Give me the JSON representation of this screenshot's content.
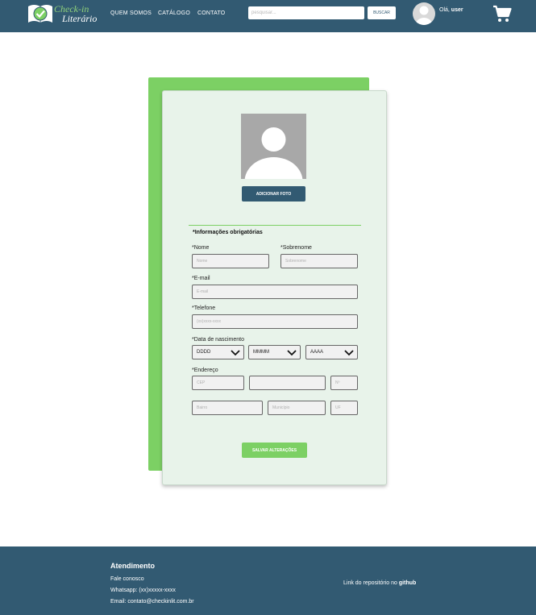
{
  "header": {
    "logo_line1": "Check-in",
    "logo_line2": "Literário",
    "nav": [
      "QUEM SOMOS",
      "CATÁLOGO",
      "CONTATO"
    ],
    "search_placeholder": "pesquisar...",
    "search_button": "BUSCAR",
    "greeting": "Olá,",
    "username": "user"
  },
  "profile": {
    "add_photo_label": "ADICIONAR FOTO",
    "section_title": "*Informações obrigatórias",
    "first_name_label": "*Nome",
    "first_name_placeholder": "Nome",
    "last_name_label": "*Sobrenome",
    "last_name_placeholder": "Sobrenome",
    "email_label": "*E-mail",
    "email_placeholder": "E-mail",
    "phone_label": "*Telefone",
    "phone_placeholder": "(xx)xxxx-xxxx",
    "birth_label": "*Data de nascimento",
    "birth_day": "DDDD",
    "birth_month": "MMMM",
    "birth_year": "AAAA",
    "address_label": "*Endereço",
    "cep_placeholder": "CEP",
    "street_placeholder": "",
    "number_placeholder": "Nº",
    "district_placeholder": "Bairro",
    "city_placeholder": "Município",
    "state_placeholder": "UF",
    "save_label": "SALVAR ALTERAÇÕES"
  },
  "footer": {
    "title": "Atendimento",
    "contact": "Fale conosco",
    "whatsapp": "Whatsapp: (xx)xxxxx-xxxx",
    "email": "Email: contato@checkinlit.com.br",
    "repo_text": "Link do repositório no",
    "repo_link": "github"
  },
  "colors": {
    "primary": "#325a72",
    "accent": "#7cd064",
    "card_bg": "#e8f3ea"
  },
  "icons": [
    "book-check-icon",
    "user-avatar-icon",
    "shopping-cart-icon",
    "chevron-down-icon"
  ]
}
